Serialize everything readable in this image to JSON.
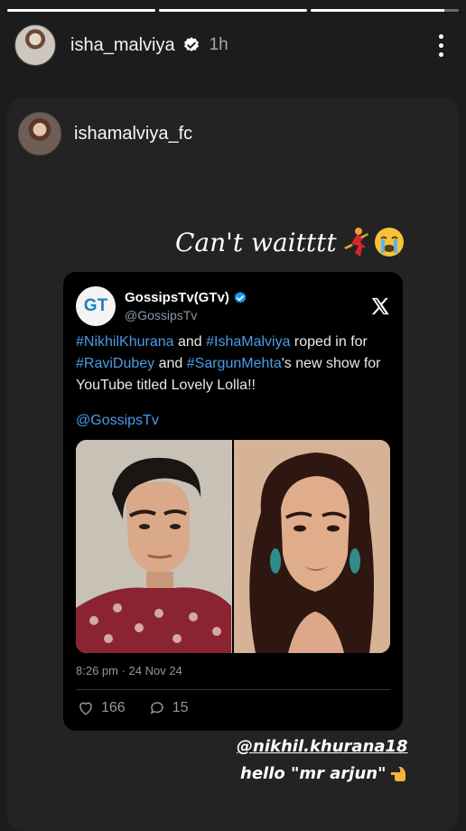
{
  "progress": {
    "segments": 3,
    "active_segment": 3,
    "active_fill_fraction": 0.9
  },
  "header": {
    "username": "isha_malviya",
    "time": "1h"
  },
  "repost": {
    "username": "ishamalviya_fc",
    "caption": "Can't waitttt"
  },
  "tweet": {
    "account_name": "GossipsTv(GTv)",
    "handle": "@GossipsTv",
    "logo_text": "GT",
    "text_parts": [
      {
        "text": "#NikhilKhurana",
        "tag": true
      },
      {
        "text": " and ",
        "tag": false
      },
      {
        "text": "#IshaMalviya",
        "tag": true
      },
      {
        "text": " roped in for ",
        "tag": false
      },
      {
        "text": "#RaviDubey",
        "tag": true
      },
      {
        "text": " and ",
        "tag": false
      },
      {
        "text": "#SargunMehta",
        "tag": true
      },
      {
        "text": "'s new show for YouTube titled Lovely Lolla!!",
        "tag": false
      }
    ],
    "mention": "@GossipsTv",
    "timestamp": "8:26 pm · 24 Nov 24",
    "likes": "166",
    "replies": "15"
  },
  "stickers": {
    "mention": "@nikhil.khurana18",
    "hello": "hello \"mr arjun\""
  },
  "colors": {
    "background": "#1c1c1c",
    "link_blue": "#4a9be8",
    "verified_blue": "#1d9bf0"
  }
}
